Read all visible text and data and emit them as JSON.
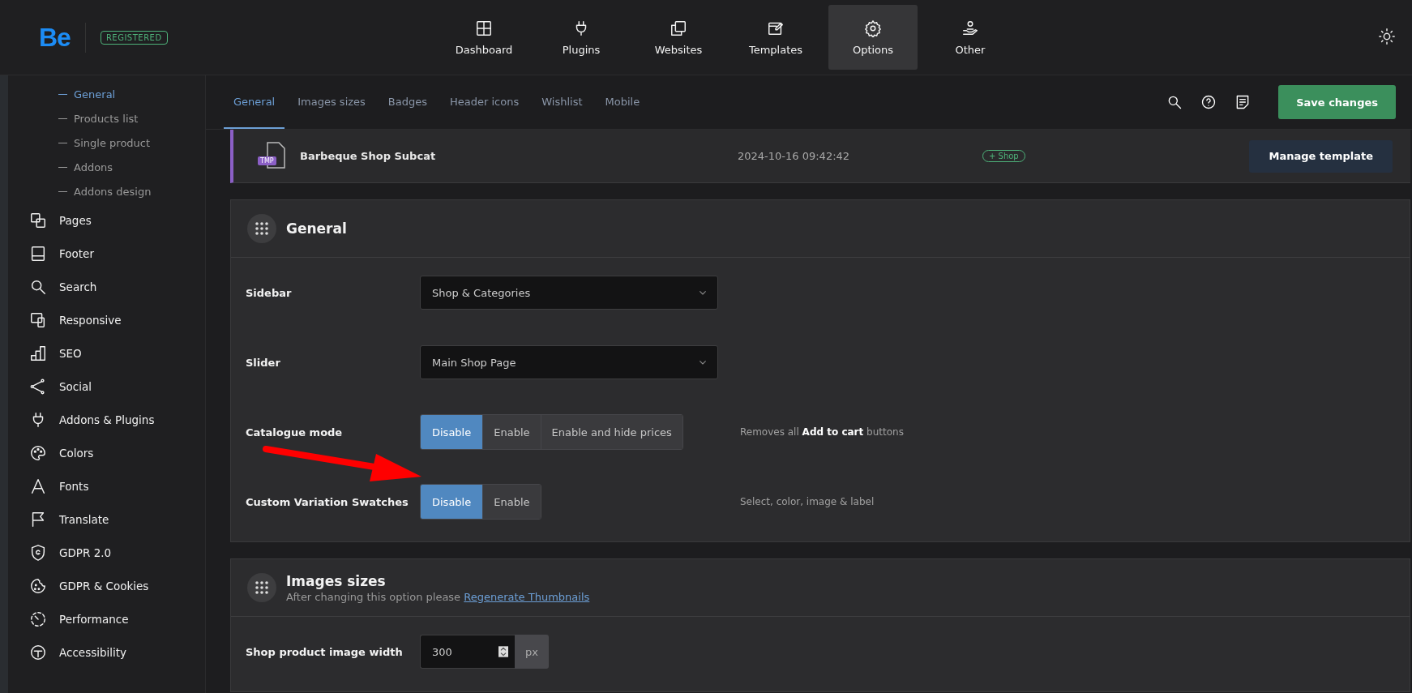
{
  "top_bar": {
    "logo": "Be",
    "badge": "REGISTERED",
    "nav": [
      {
        "label": "Dashboard",
        "selected": false
      },
      {
        "label": "Plugins",
        "selected": false
      },
      {
        "label": "Websites",
        "selected": false
      },
      {
        "label": "Templates",
        "selected": false
      },
      {
        "label": "Options",
        "selected": true
      },
      {
        "label": "Other",
        "selected": false
      }
    ]
  },
  "sidebar": {
    "subitems": [
      {
        "label": "General",
        "selected": true
      },
      {
        "label": "Products list",
        "selected": false
      },
      {
        "label": "Single product",
        "selected": false
      },
      {
        "label": "Addons",
        "selected": false
      },
      {
        "label": "Addons design",
        "selected": false
      }
    ],
    "items": [
      "Pages",
      "Footer",
      "Search",
      "Responsive",
      "SEO",
      "Social",
      "Addons & Plugins",
      "Colors",
      "Fonts",
      "Translate",
      "GDPR 2.0",
      "GDPR & Cookies",
      "Performance",
      "Accessibility"
    ]
  },
  "tabs": [
    {
      "label": "General",
      "selected": true
    },
    {
      "label": "Images sizes",
      "selected": false
    },
    {
      "label": "Badges",
      "selected": false
    },
    {
      "label": "Header icons",
      "selected": false
    },
    {
      "label": "Wishlist",
      "selected": false
    },
    {
      "label": "Mobile",
      "selected": false
    }
  ],
  "save_button": "Save changes",
  "template": {
    "badge": "TMP",
    "name": "Barbeque Shop Subcat",
    "date": "2024-10-16 09:42:42",
    "tag": "+ Shop",
    "button": "Manage template"
  },
  "sections": [
    {
      "title": "General",
      "rows": [
        {
          "kind": "select",
          "label": "Sidebar",
          "value": "Shop & Categories"
        },
        {
          "kind": "select",
          "label": "Slider",
          "value": "Main Shop Page"
        },
        {
          "kind": "segmented",
          "label": "Catalogue mode",
          "options": [
            {
              "label": "Disable",
              "selected": true
            },
            {
              "label": "Enable",
              "selected": false
            },
            {
              "label": "Enable and hide prices",
              "selected": false
            }
          ],
          "description": "Removes all **Add to cart** buttons"
        },
        {
          "kind": "segmented",
          "label": "Custom Variation Swatches",
          "options": [
            {
              "label": "Disable",
              "selected": true
            },
            {
              "label": "Enable",
              "selected": false
            }
          ],
          "description": "Select, color, image & label"
        }
      ]
    },
    {
      "title": "Images sizes",
      "subtitle": "After changing this option please",
      "link": "Regenerate Thumbnails",
      "rows": [
        {
          "kind": "number",
          "label": "Shop product image width",
          "value": "300",
          "unit": "px"
        }
      ]
    }
  ],
  "annotations": [
    {
      "kind": "arrow",
      "color": "#ff0000"
    }
  ]
}
